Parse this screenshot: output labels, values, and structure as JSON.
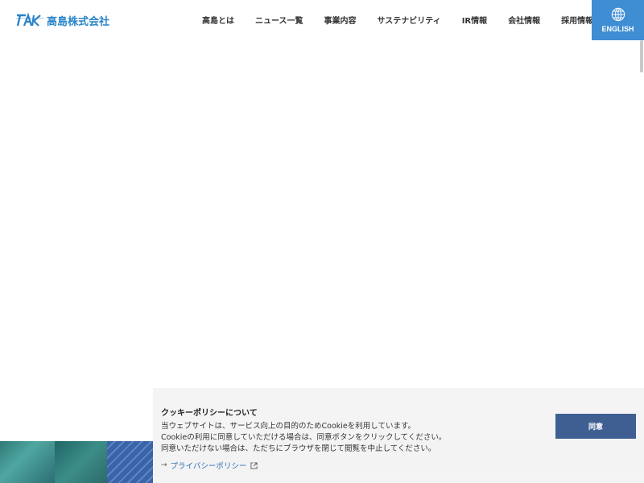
{
  "header": {
    "logo_text": "高島株式会社",
    "nav": [
      {
        "label": "高島とは"
      },
      {
        "label": "ニュース一覧"
      },
      {
        "label": "事業内容"
      },
      {
        "label": "サステナビリティ"
      },
      {
        "label": "IR情報"
      },
      {
        "label": "会社情報"
      },
      {
        "label": "採用情報"
      }
    ],
    "english_label": "ENGLISH",
    "english_icon": "globe-icon"
  },
  "cookie_banner": {
    "title": "クッキーポリシーについて",
    "lines": [
      "当ウェブサイトは、サービス向上の目的のためCookieを利用しています。",
      "Cookieの利用に同意していただける場合は、同意ボタンをクリックしてください。",
      "同意いただけない場合は、ただちにブラウザを閉じて閲覧を中止してください。"
    ],
    "link_arrow": "→",
    "link_label": "プライバシーポリシー",
    "agree_label": "同意"
  },
  "colors": {
    "brand_blue": "#2a84c8",
    "english_bg": "#3f8dd3",
    "agree_bg": "#3f5f93",
    "link": "#2f6fb6"
  }
}
